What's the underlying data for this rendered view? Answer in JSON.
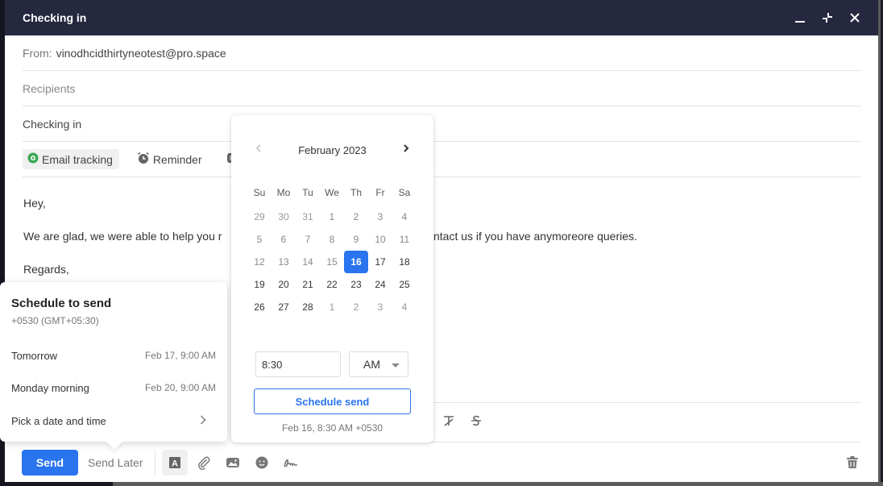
{
  "window": {
    "title": "Checking in",
    "controls": [
      "minimize-icon",
      "collapse-icon",
      "close-icon"
    ]
  },
  "compose": {
    "from_label": "From:",
    "from_value": "vinodhcidthirtyneotest@pro.space",
    "recipients_placeholder": "Recipients",
    "subject": "Checking in",
    "options": [
      {
        "label": "Email tracking",
        "icon": "eye-icon",
        "active": true
      },
      {
        "label": "Reminder",
        "icon": "alarm-clock-icon",
        "active": false
      },
      {
        "label": "",
        "icon": "template-icon",
        "active": false
      }
    ],
    "body": {
      "greeting": "Hey,",
      "line1_left": "We are glad, we were able to help you r",
      "line1_right": "ntact us if you have anymoreore queries.",
      "signoff": "Regards,"
    }
  },
  "format_toolbar": {
    "icons": [
      "clear-format-icon",
      "strikethrough-icon"
    ]
  },
  "bottom_bar": {
    "send_label": "Send",
    "send_later_label": "Send Later",
    "tools": [
      "text-format-icon",
      "attachment-icon",
      "image-icon",
      "emoji-icon",
      "signature-icon"
    ],
    "trash": "trash-icon"
  },
  "schedule_menu": {
    "title": "Schedule to send",
    "timezone": "+0530 (GMT+05:30)",
    "options": [
      {
        "label": "Tomorrow",
        "when": "Feb 17, 9:00 AM"
      },
      {
        "label": "Monday morning",
        "when": "Feb 20, 9:00 AM"
      },
      {
        "label": "Pick a date and time",
        "when": ""
      }
    ]
  },
  "date_picker": {
    "month_label": "February 2023",
    "weekdays": [
      "Su",
      "Mo",
      "Tu",
      "We",
      "Th",
      "Fr",
      "Sa"
    ],
    "weeks": [
      [
        {
          "d": "29",
          "t": "other"
        },
        {
          "d": "30",
          "t": "other"
        },
        {
          "d": "31",
          "t": "other"
        },
        {
          "d": "1",
          "t": "past"
        },
        {
          "d": "2",
          "t": "past"
        },
        {
          "d": "3",
          "t": "past"
        },
        {
          "d": "4",
          "t": "past"
        }
      ],
      [
        {
          "d": "5",
          "t": "past"
        },
        {
          "d": "6",
          "t": "past"
        },
        {
          "d": "7",
          "t": "past"
        },
        {
          "d": "8",
          "t": "past"
        },
        {
          "d": "9",
          "t": "past"
        },
        {
          "d": "10",
          "t": "past"
        },
        {
          "d": "11",
          "t": "past"
        }
      ],
      [
        {
          "d": "12",
          "t": "past"
        },
        {
          "d": "13",
          "t": "past"
        },
        {
          "d": "14",
          "t": "past"
        },
        {
          "d": "15",
          "t": "past"
        },
        {
          "d": "16",
          "t": "sel"
        },
        {
          "d": "17",
          "t": "cur"
        },
        {
          "d": "18",
          "t": "cur"
        }
      ],
      [
        {
          "d": "19",
          "t": "cur"
        },
        {
          "d": "20",
          "t": "cur"
        },
        {
          "d": "21",
          "t": "cur"
        },
        {
          "d": "22",
          "t": "cur"
        },
        {
          "d": "23",
          "t": "cur"
        },
        {
          "d": "24",
          "t": "cur"
        },
        {
          "d": "25",
          "t": "cur"
        }
      ],
      [
        {
          "d": "26",
          "t": "cur"
        },
        {
          "d": "27",
          "t": "cur"
        },
        {
          "d": "28",
          "t": "cur"
        },
        {
          "d": "1",
          "t": "other"
        },
        {
          "d": "2",
          "t": "other"
        },
        {
          "d": "3",
          "t": "other"
        },
        {
          "d": "4",
          "t": "other"
        }
      ]
    ],
    "selected_day": "16",
    "time_value": "8:30",
    "ampm_value": "AM",
    "schedule_button": "Schedule send",
    "preview": "Feb 16, 8:30 AM +0530"
  },
  "colors": {
    "titlebar": "#262840",
    "accent": "#2a74ef",
    "tracking_green": "#3aa757"
  }
}
